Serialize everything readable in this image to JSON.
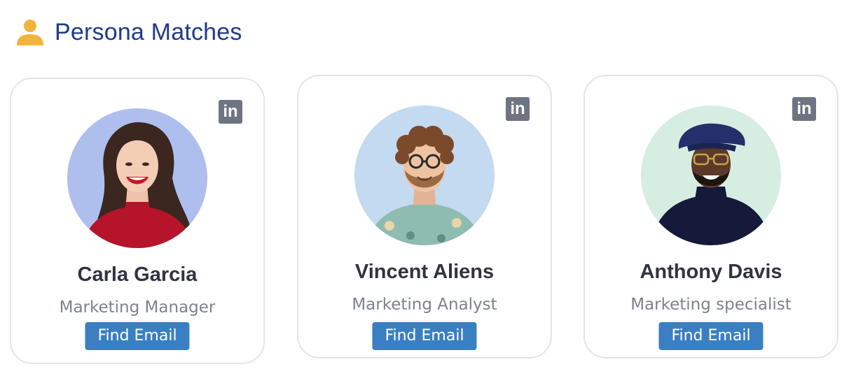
{
  "header": {
    "title": "Persona Matches",
    "icon": "person-icon",
    "icon_color": "#f2b33d",
    "title_color": "#1f3a8a"
  },
  "personas": [
    {
      "name": "Carla Garcia",
      "role": "Marketing Manager",
      "button_label": "Find Email",
      "avatar_bg": "#aebfee",
      "social_icon": "linkedin-icon",
      "social_text": "in"
    },
    {
      "name": "Vincent Aliens",
      "role": "Marketing Analyst",
      "button_label": "Find Email",
      "avatar_bg": "#c4daf0",
      "social_icon": "linkedin-icon",
      "social_text": "in"
    },
    {
      "name": "Anthony Davis",
      "role": "Marketing specialist",
      "button_label": "Find Email",
      "avatar_bg": "#d6ede2",
      "social_icon": "linkedin-icon",
      "social_text": "in"
    }
  ],
  "colors": {
    "button": "#3a7fc1",
    "card_border": "#e3e5ea",
    "name_text": "#2f3440",
    "role_text": "#7d828e",
    "linkedin_bg": "#6f7482"
  }
}
